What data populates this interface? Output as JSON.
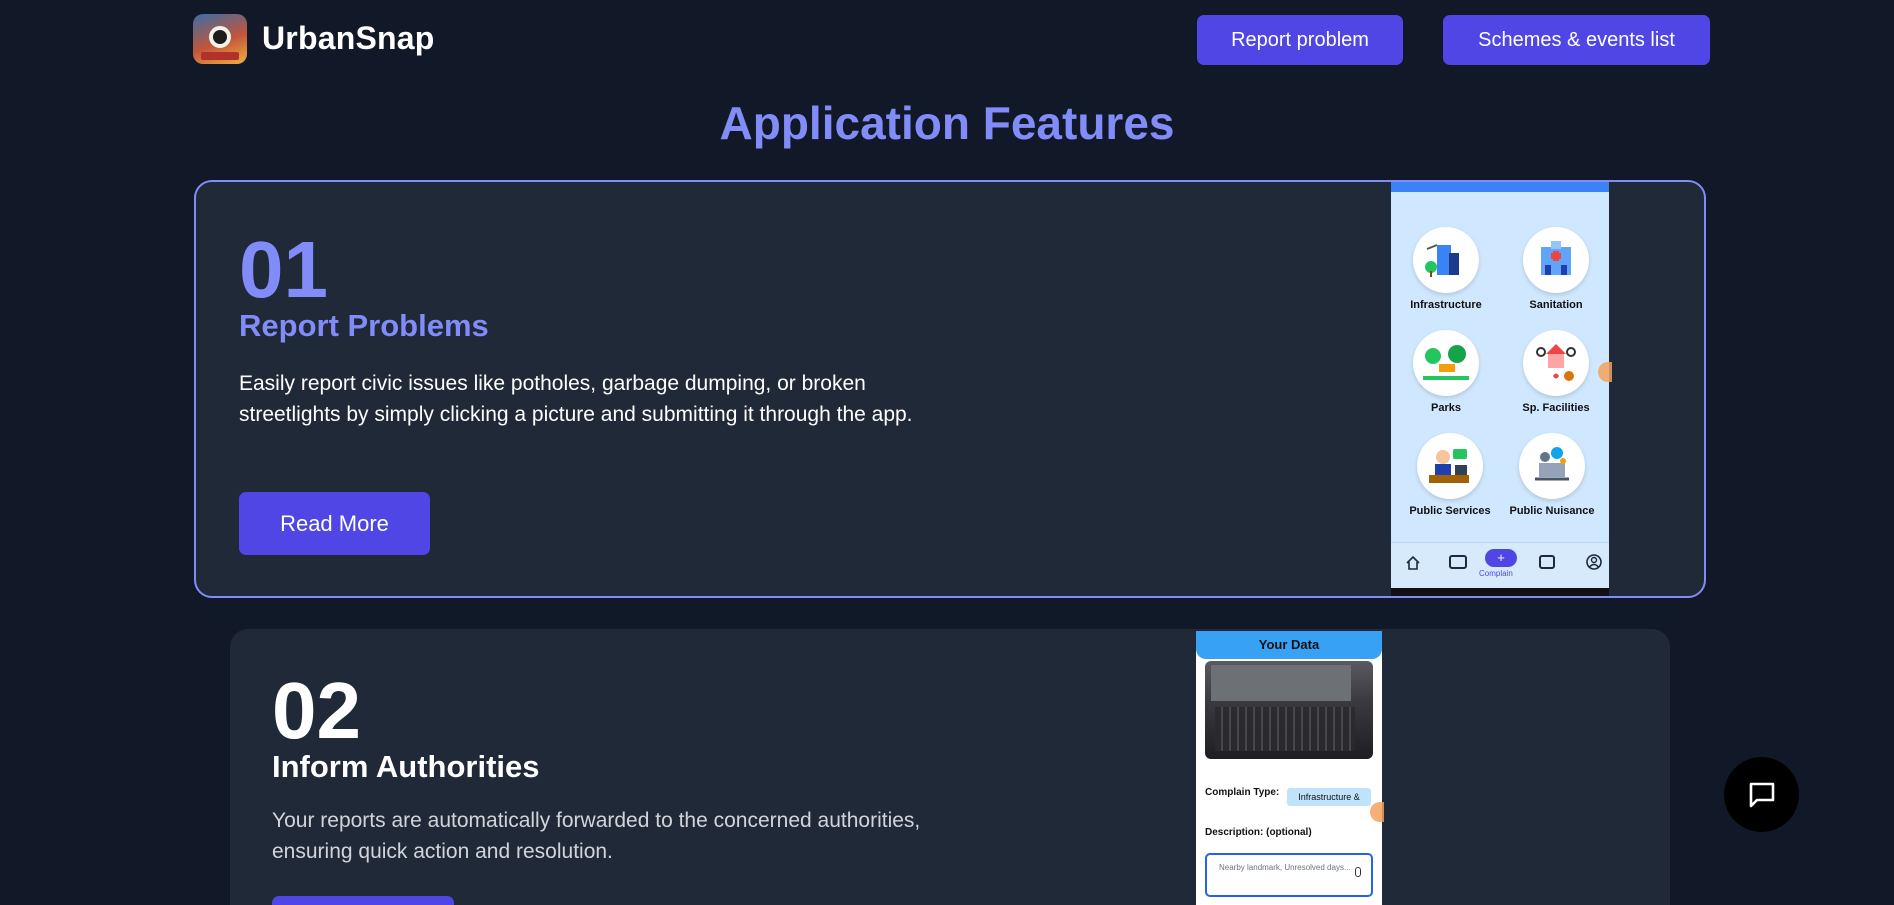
{
  "header": {
    "brand": "UrbanSnap",
    "report_label": "Report problem",
    "schemes_label": "Schemes & events list"
  },
  "section_title": "Application Features",
  "features": [
    {
      "number": "01",
      "title": "Report Problems",
      "description": "Easily report civic issues like potholes, garbage dumping, or broken streetlights by simply clicking a picture and submitting it through the app.",
      "button": "Read More",
      "mockup": {
        "categories": [
          "Infrastructure",
          "Sanitation",
          "Parks",
          "Sp. Facilities",
          "Public Services",
          "Public Nuisance"
        ],
        "active_tab": "Complain"
      }
    },
    {
      "number": "02",
      "title": "Inform Authorities",
      "description": "Your reports are automatically forwarded to the concerned authorities, ensuring quick action and resolution.",
      "mockup": {
        "header": "Your Data",
        "complain_type_label": "Complain Type:",
        "complain_type_value": "Infrastructure &",
        "description_label": "Description: (optional)",
        "description_placeholder": "Nearby landmark, Unresolved days..."
      }
    }
  ],
  "colors": {
    "background": "#111827",
    "card": "#1f2937",
    "accent": "#4f46e5",
    "accent_text": "#818cf8"
  },
  "icons": {
    "chat": "chat-bubble-icon"
  }
}
